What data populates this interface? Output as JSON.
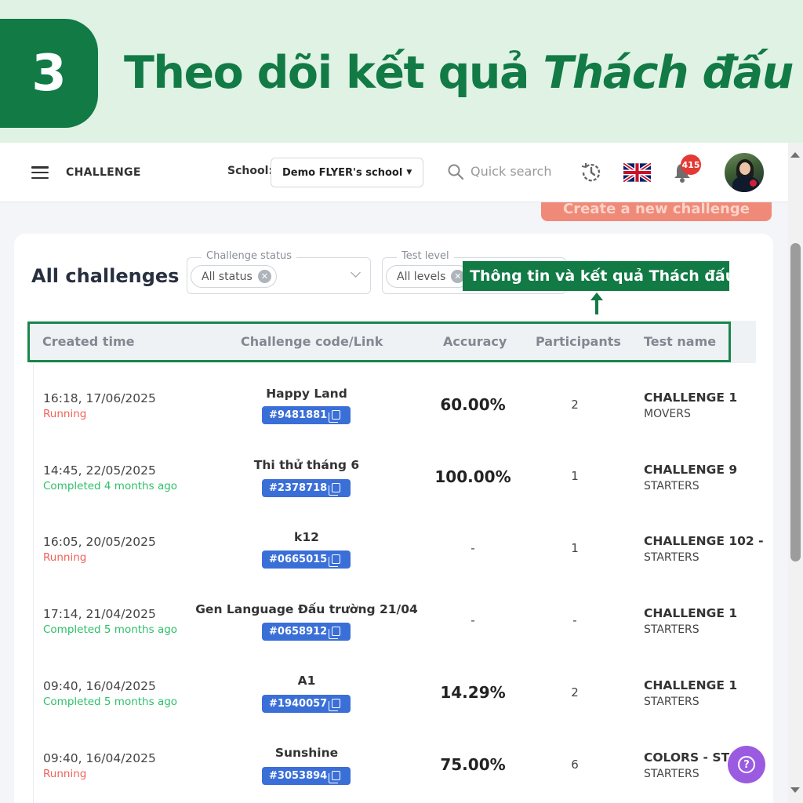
{
  "banner": {
    "step": "3",
    "title_regular": "Theo dõi kết quả ",
    "title_italic": "Thách đấu"
  },
  "topbar": {
    "app_title": "CHALLENGE",
    "school_label": "School:",
    "school_value": "Demo FLYER's school",
    "search_placeholder": "Quick search",
    "notification_count": "415",
    "icons": [
      "menu-icon",
      "search-icon",
      "history-icon",
      "uk-flag-icon",
      "bell-icon",
      "avatar"
    ]
  },
  "create_button": "Create a new challenge",
  "page_title": "All challenges",
  "filters": {
    "status": {
      "label": "Challenge status",
      "value": "All status"
    },
    "level": {
      "label": "Test level",
      "value": "All levels"
    }
  },
  "callout": "Thông tin và kết quả Thách đấu",
  "table": {
    "headers": [
      "Created time",
      "Challenge code/Link",
      "Accuracy",
      "Participants",
      "Test name"
    ],
    "rows": [
      {
        "created": "16:18, 17/06/2025",
        "status": "Running",
        "status_type": "running",
        "name": "Happy Land",
        "code": "#9481881",
        "accuracy": "60.00%",
        "participants": "2",
        "test_name": "CHALLENGE 1",
        "level": "MOVERS"
      },
      {
        "created": "14:45, 22/05/2025",
        "status": "Completed 4 months ago",
        "status_type": "completed",
        "name": "Thi thử tháng 6",
        "code": "#2378718",
        "accuracy": "100.00%",
        "participants": "1",
        "test_name": "CHALLENGE 9",
        "level": "STARTERS"
      },
      {
        "created": "16:05, 20/05/2025",
        "status": "Running",
        "status_type": "running",
        "name": "k12",
        "code": "#0665015",
        "accuracy": "-",
        "participants": "1",
        "test_name": "CHALLENGE 102 -",
        "level": "STARTERS"
      },
      {
        "created": "17:14, 21/04/2025",
        "status": "Completed 5 months ago",
        "status_type": "completed",
        "name": "Gen Language Đấu trường 21/04",
        "code": "#0658912",
        "accuracy": "-",
        "participants": "-",
        "test_name": "CHALLENGE 1",
        "level": "STARTERS"
      },
      {
        "created": "09:40, 16/04/2025",
        "status": "Completed 5 months ago",
        "status_type": "completed",
        "name": "A1",
        "code": "#1940057",
        "accuracy": "14.29%",
        "participants": "2",
        "test_name": "CHALLENGE 1",
        "level": "STARTERS"
      },
      {
        "created": "09:40, 16/04/2025",
        "status": "Running",
        "status_type": "running",
        "name": "Sunshine",
        "code": "#3053894",
        "accuracy": "75.00%",
        "participants": "6",
        "test_name": "COLORS - STA",
        "level": "STARTERS"
      }
    ]
  },
  "help_button": "?",
  "colors": {
    "brand_green": "#117a45",
    "code_blue": "#3b6fd8",
    "running": "#f0625a",
    "completed": "#2ec06a",
    "help_purple": "#9b5be0"
  }
}
